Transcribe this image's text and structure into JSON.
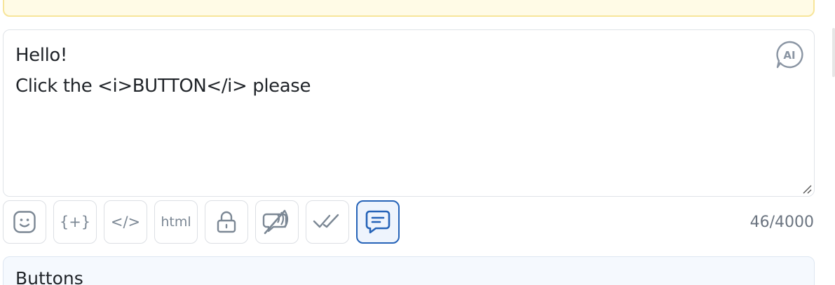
{
  "editor": {
    "text": "Hello!\nClick the <i>BUTTON</i> please",
    "ai_label": "AI"
  },
  "toolbar": {
    "emoji": "emoji-icon",
    "variables_label": "{+}",
    "code_label": "</>",
    "html_label": "html",
    "lock": "lock-icon",
    "mute": "mute-icon",
    "read": "double-check-icon",
    "comment": "comment-icon"
  },
  "counter": "46/4000",
  "buttons_section": {
    "title": "Buttons"
  },
  "colors": {
    "active_border": "#2563b8",
    "icon_gray": "#7b8794",
    "warning_bg": "#fffbe6",
    "warning_border": "#f7e59a"
  }
}
